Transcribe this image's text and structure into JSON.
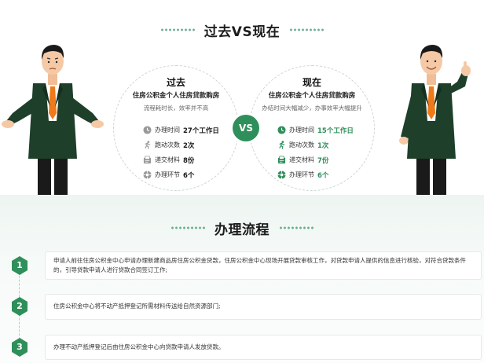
{
  "compare": {
    "title": "过去VS现在",
    "vs_label": "VS",
    "left": {
      "heading": "过去",
      "subtitle": "住房公积金个人住房贷款购房",
      "desc": "流程耗时长，效率并不高",
      "rows": [
        {
          "label": "办理时间",
          "value": "27个工作日",
          "icon": "clock-icon"
        },
        {
          "label": "跑动次数",
          "value": "2次",
          "icon": "running-icon"
        },
        {
          "label": "递交材料",
          "value": "8份",
          "icon": "documents-icon"
        },
        {
          "label": "办理环节",
          "value": "6个",
          "icon": "steps-icon"
        }
      ]
    },
    "right": {
      "heading": "现在",
      "subtitle": "住房公积金个人住房贷款购房",
      "desc": "办结时间大幅减少，办事效率大幅提升",
      "rows": [
        {
          "label": "办理时间",
          "value": "15个工作日",
          "icon": "clock-icon"
        },
        {
          "label": "跑动次数",
          "value": "1次",
          "icon": "running-icon"
        },
        {
          "label": "递交材料",
          "value": "7份",
          "icon": "documents-icon"
        },
        {
          "label": "办理环节",
          "value": "6个",
          "icon": "steps-icon"
        }
      ]
    }
  },
  "process": {
    "title": "办理流程",
    "steps": [
      {
        "num": "1",
        "text": "申请人前往住房公积金中心申请办理新建商品房住房公积金贷款，住房公积金中心现场开展贷款审核工作，对贷款申请人提供的信息进行核验，对符合贷款条件的，引导贷款申请人进行贷款合同签订工作;"
      },
      {
        "num": "2",
        "text": "住房公积金中心将不动产抵押登记所需材料传送给自然资源部门;"
      },
      {
        "num": "3",
        "text": "办理不动产抵押登记后由住房公积金中心向贷款申请人发放贷款。"
      }
    ]
  },
  "colors": {
    "accent": "#2f8f5a",
    "suit": "#1e3f2a",
    "tie": "#f07a1a"
  }
}
